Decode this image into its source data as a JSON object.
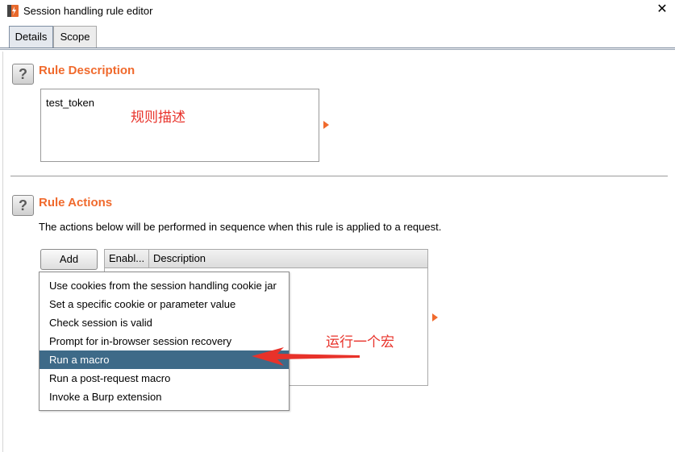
{
  "window": {
    "title": "Session handling rule editor",
    "close": "✕"
  },
  "tabs": [
    {
      "label": "Details"
    },
    {
      "label": "Scope"
    }
  ],
  "rule_description": {
    "help": "?",
    "title": "Rule Description",
    "value": "test_token",
    "annotation": "规则描述"
  },
  "rule_actions": {
    "help": "?",
    "title": "Rule Actions",
    "instructions": "The actions below will be performed in sequence when this rule is applied to a request.",
    "add_label": "Add",
    "columns": [
      "Enabl...",
      "Description"
    ],
    "annotation": "运行一个宏"
  },
  "add_menu": {
    "items": [
      "Use cookies from the session handling cookie jar",
      "Set a specific cookie or parameter value",
      "Check session is valid",
      "Prompt for in-browser session recovery",
      "Run a macro",
      "Run a post-request macro",
      "Invoke a Burp extension"
    ],
    "selected_index": 4
  },
  "colors": {
    "accent": "#f06a2d",
    "annotation": "#e8322a",
    "selection": "#3e6a88"
  }
}
